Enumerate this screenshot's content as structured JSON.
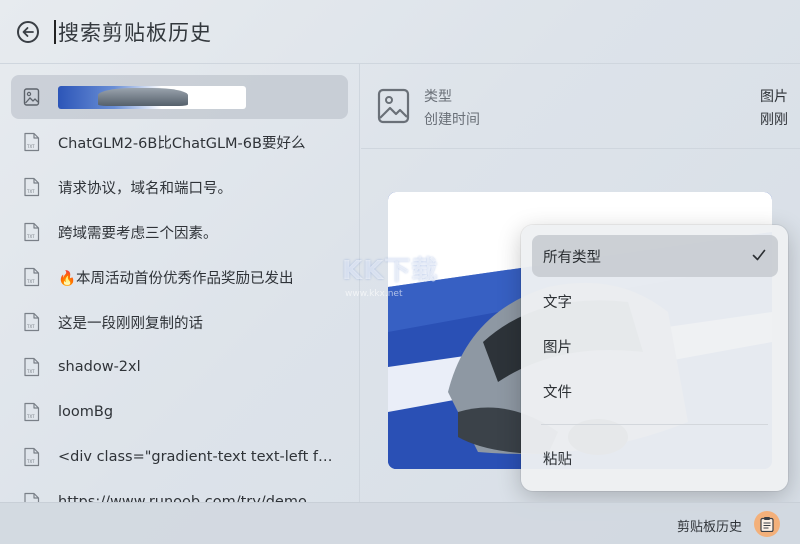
{
  "header": {
    "search_text": "搜索剪贴板历史"
  },
  "list": {
    "items": [
      {
        "type": "image",
        "text": ""
      },
      {
        "type": "text",
        "text": "ChatGLM2-6B比ChatGLM-6B要好么"
      },
      {
        "type": "text",
        "text": "请求协议，域名和端口号。"
      },
      {
        "type": "text",
        "text": "跨域需要考虑三个因素。"
      },
      {
        "type": "text",
        "text": "🔥本周活动首份优秀作品奖励已发出"
      },
      {
        "type": "text",
        "text": "这是一段刚刚复制的话"
      },
      {
        "type": "text",
        "text": "shadow-2xl"
      },
      {
        "type": "text",
        "text": "loomBg"
      },
      {
        "type": "text",
        "text": "<div class=\"gradient-text text-left font-e…"
      },
      {
        "type": "text",
        "text": "https://www.runoob.com/try/demo_sour"
      }
    ]
  },
  "detail": {
    "type_label": "类型",
    "type_value": "图片",
    "created_label": "创建时间",
    "created_value": "刚刚"
  },
  "menu": {
    "items": [
      "所有类型",
      "文字",
      "图片",
      "文件"
    ],
    "selected": "所有类型",
    "paste": "粘贴"
  },
  "watermark": {
    "title": "KK下载",
    "sub": "www.kkx.net"
  },
  "footer": {
    "label": "剪贴板历史"
  },
  "colors": {
    "accent_button": "#f3b07a",
    "preview_blue": "#2a4fb2"
  }
}
